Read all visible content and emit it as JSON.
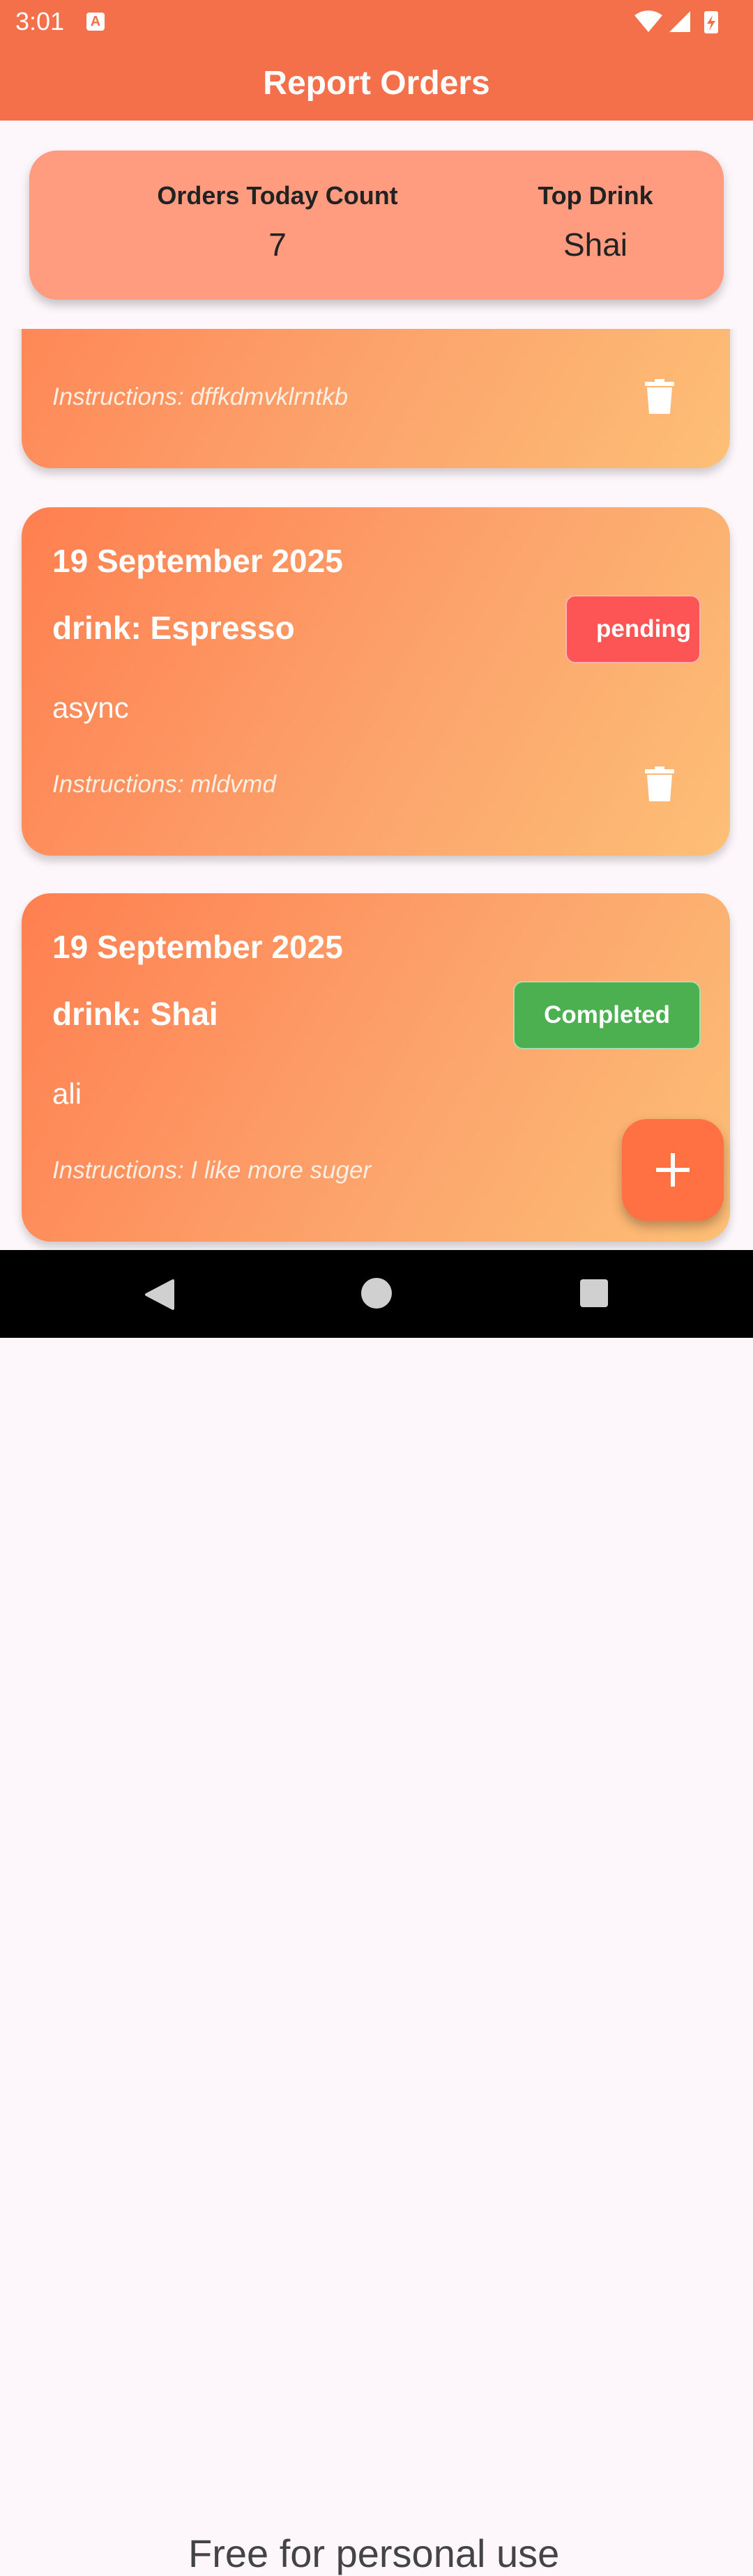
{
  "status_bar": {
    "time": "3:01",
    "notification_icon": "a-icon"
  },
  "app_bar": {
    "title": "Report Orders"
  },
  "summary": {
    "orders_label": "Orders Today Count",
    "orders_value": "7",
    "top_drink_label": "Top Drink",
    "top_drink_value": "Shai"
  },
  "orders": [
    {
      "date": "",
      "drink": "",
      "name": "",
      "instructions": "Instructions: dffkdmvklrntkb",
      "status": ""
    },
    {
      "date": "19 September 2025",
      "drink": "drink: Espresso",
      "name": "async",
      "instructions": "Instructions: mldvmd",
      "status": "pending"
    },
    {
      "date": "19 September 2025",
      "drink": "drink: Shai",
      "name": "ali",
      "instructions": "Instructions: I like more suger",
      "status": "Completed"
    }
  ],
  "colors": {
    "accent": "#f3704b",
    "summary_bg": "#ff9c80",
    "pending": "#fd5555",
    "completed": "#4caf50",
    "fab": "#ff7043"
  },
  "watermark": "Free for personal use"
}
